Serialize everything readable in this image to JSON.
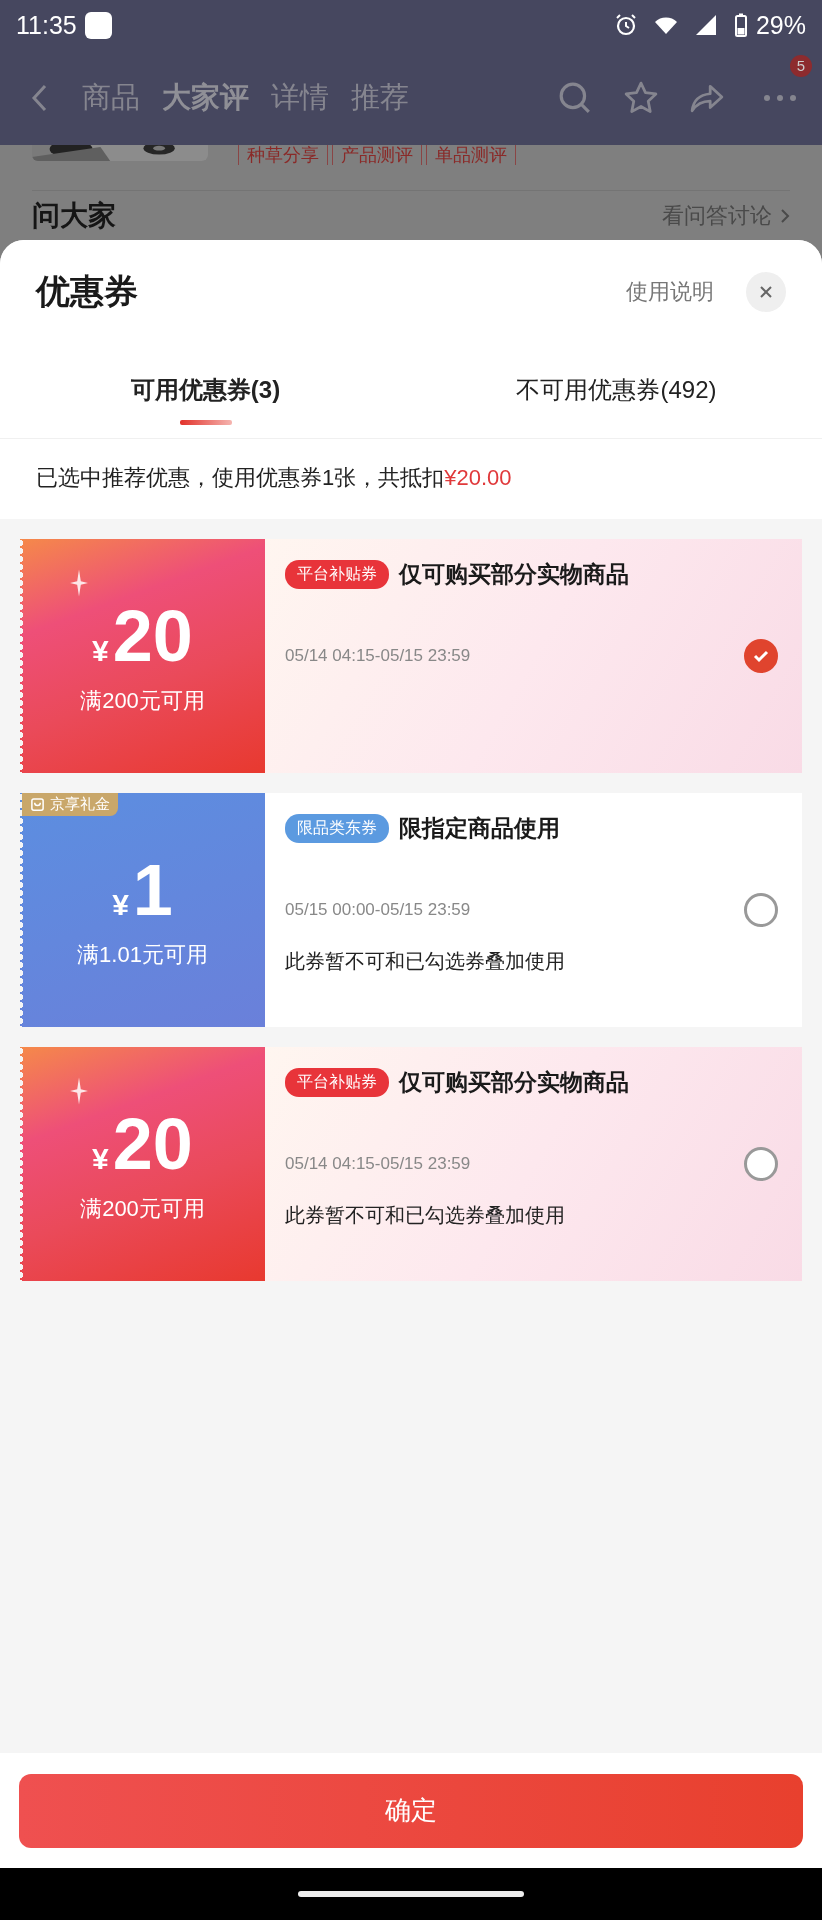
{
  "status_bar": {
    "time": "11:35",
    "battery": "29%"
  },
  "nav": {
    "tabs": [
      {
        "label": "商品",
        "selected": false
      },
      {
        "label": "大家评",
        "selected": true
      },
      {
        "label": "详情",
        "selected": false
      },
      {
        "label": "推荐",
        "selected": false
      }
    ],
    "more_badge": "5"
  },
  "background_page": {
    "tags": [
      "种草分享",
      "产品测评",
      "单品测评"
    ],
    "section_title": "问大家",
    "section_link": "看问答讨论"
  },
  "sheet": {
    "title": "优惠券",
    "help": "使用说明",
    "tabs": [
      {
        "label": "可用优惠券(3)",
        "selected": true
      },
      {
        "label": "不可用优惠券(492)",
        "selected": false
      }
    ],
    "summary": "已选中推荐优惠，使用优惠券1张，共抵扣",
    "summary_amount": "¥20.00"
  },
  "coupons": [
    {
      "kind": "red",
      "currency": "¥",
      "amount": "20",
      "condition": "满200元可用",
      "tag": "平台补贴券",
      "color": "#e8343a",
      "title": "仅可购买部分实物商品",
      "validity": "05/14 04:15-05/15 23:59",
      "selected": true
    },
    {
      "kind": "blue",
      "corner_label": "京享礼金",
      "currency": "¥",
      "amount": "1",
      "condition": "满1.01元可用",
      "tag": "限品类东券",
      "color": "#5b9ae0",
      "title": "限指定商品使用",
      "validity": "05/15 00:00-05/15 23:59",
      "note": "此券暂不可和已勾选券叠加使用",
      "selected": false
    },
    {
      "kind": "red",
      "currency": "¥",
      "amount": "20",
      "condition": "满200元可用",
      "tag": "平台补贴券",
      "color": "#e8343a",
      "title": "仅可购买部分实物商品",
      "validity": "05/14 04:15-05/15 23:59",
      "note": "此券暂不可和已勾选券叠加使用",
      "selected": false
    }
  ],
  "confirm": "确定"
}
